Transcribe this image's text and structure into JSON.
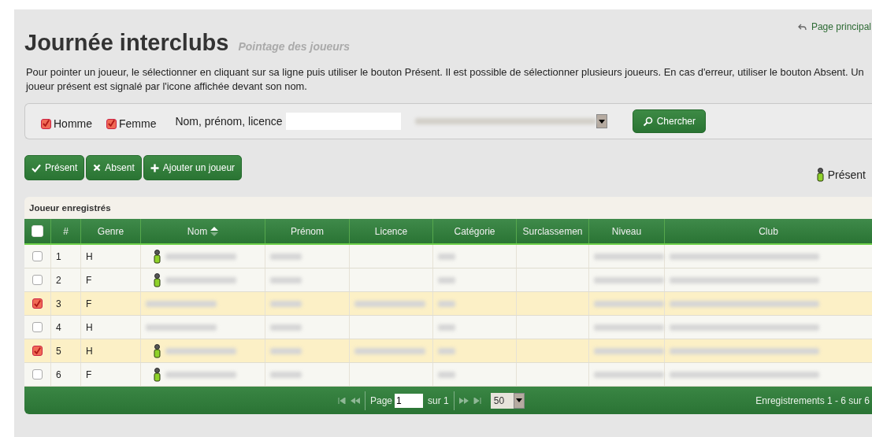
{
  "header": {
    "title": "Journée interclubs",
    "subtitle": "Pointage des joueurs",
    "home_link": "Page principal"
  },
  "instructions": "Pour pointer un joueur, le sélectionner en cliquant sur sa ligne puis utiliser le bouton Présent. Il est possible de sélectionner plusieurs joueurs. En cas d'erreur, utiliser le bouton Absent. Un joueur présent est signalé par l'icone affichée devant son nom.",
  "filters": {
    "checkboxes": [
      {
        "label": "Homme",
        "checked": true
      },
      {
        "label": "Femme",
        "checked": true
      }
    ],
    "search_label": "Nom, prénom, licence",
    "search_button": "Chercher"
  },
  "actions": [
    {
      "kind": "check",
      "label": "Présent"
    },
    {
      "kind": "cross",
      "label": "Absent"
    },
    {
      "kind": "plus",
      "label": "Ajouter un joueur"
    }
  ],
  "legend": "Présent",
  "table": {
    "caption": "Joueur enregistrés",
    "select_all_checked": false,
    "columns": [
      "#",
      "Genre",
      "Nom",
      "Prénom",
      "Licence",
      "Catégorie",
      "Surclassemen",
      "Niveau",
      "Club"
    ],
    "rows": [
      {
        "number": "1",
        "genre": "H",
        "selected": false,
        "present": true,
        "has_licence": false
      },
      {
        "number": "2",
        "genre": "F",
        "selected": false,
        "present": true,
        "has_licence": false
      },
      {
        "number": "3",
        "genre": "F",
        "selected": true,
        "present": false,
        "has_licence": true
      },
      {
        "number": "4",
        "genre": "H",
        "selected": false,
        "present": false,
        "has_licence": false
      },
      {
        "number": "5",
        "genre": "H",
        "selected": true,
        "present": true,
        "has_licence": true
      },
      {
        "number": "6",
        "genre": "F",
        "selected": false,
        "present": true,
        "has_licence": false
      }
    ]
  },
  "pager": {
    "page_label": "Page",
    "page_value": "1",
    "of_label": "sur 1",
    "page_size": "50",
    "records": "Enregistrements 1 - 6 sur 6"
  }
}
